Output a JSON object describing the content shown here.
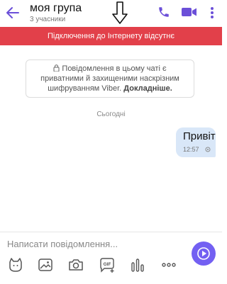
{
  "header": {
    "title": "моя група",
    "subtitle": "3 учасники"
  },
  "banner": {
    "text": "Підключення до Інтернету відсутнє"
  },
  "encryption": {
    "text": "Повідомлення в цьому чаті є приватними й захищеними наскрізним шифруванням Viber.",
    "link": "Докладніше."
  },
  "chat": {
    "date": "Сьогодні",
    "messages": [
      {
        "text": "Привіт",
        "time": "12:57"
      }
    ]
  },
  "composer": {
    "placeholder": "Написати повідомлення..."
  },
  "colors": {
    "accent": "#7360f2",
    "banner": "#e2404a",
    "bubble": "#d9e7f8"
  }
}
